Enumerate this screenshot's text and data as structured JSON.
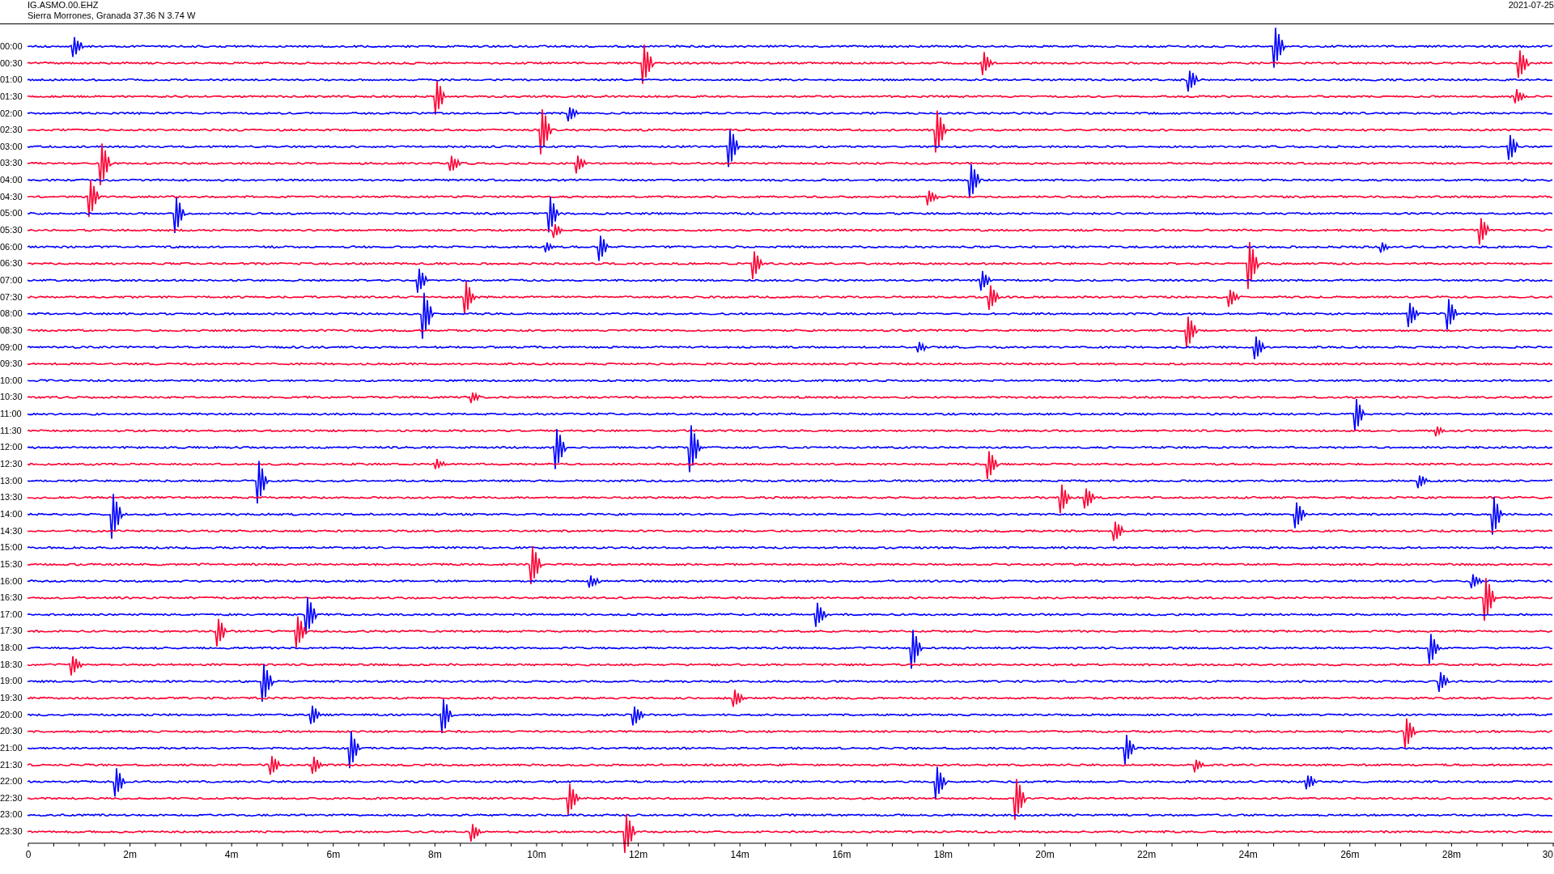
{
  "header": {
    "station": "IG.ASMO.00.EHZ",
    "location": "Sierra Morrones, Granada  37.36 N 3.74 W",
    "date": "2021-07-25"
  },
  "rows": [
    {
      "time": "00:00",
      "color": "#0000ff"
    },
    {
      "time": "00:30",
      "color": "#ff0033"
    },
    {
      "time": "01:00",
      "color": "#0000ff"
    },
    {
      "time": "01:30",
      "color": "#ff0033"
    },
    {
      "time": "02:00",
      "color": "#0000ff"
    },
    {
      "time": "02:30",
      "color": "#ff0033"
    },
    {
      "time": "03:00",
      "color": "#0000ff"
    },
    {
      "time": "03:30",
      "color": "#ff0033"
    },
    {
      "time": "04:00",
      "color": "#0000ff"
    },
    {
      "time": "04:30",
      "color": "#ff0033"
    },
    {
      "time": "05:00",
      "color": "#0000ff"
    },
    {
      "time": "05:30",
      "color": "#ff0033"
    },
    {
      "time": "06:00",
      "color": "#0000ff"
    },
    {
      "time": "06:30",
      "color": "#ff0033"
    },
    {
      "time": "07:00",
      "color": "#0000ff"
    },
    {
      "time": "07:30",
      "color": "#ff0033"
    },
    {
      "time": "08:00",
      "color": "#0000ff"
    },
    {
      "time": "08:30",
      "color": "#ff0033"
    },
    {
      "time": "09:00",
      "color": "#0000ff"
    },
    {
      "time": "09:30",
      "color": "#ff0033"
    },
    {
      "time": "10:00",
      "color": "#0000ff"
    },
    {
      "time": "10:30",
      "color": "#ff0033"
    },
    {
      "time": "11:00",
      "color": "#0000ff"
    },
    {
      "time": "11:30",
      "color": "#ff0033"
    },
    {
      "time": "12:00",
      "color": "#0000ff"
    },
    {
      "time": "12:30",
      "color": "#ff0033"
    },
    {
      "time": "13:00",
      "color": "#0000ff"
    },
    {
      "time": "13:30",
      "color": "#ff0033"
    },
    {
      "time": "14:00",
      "color": "#0000ff"
    },
    {
      "time": "14:30",
      "color": "#ff0033"
    },
    {
      "time": "15:00",
      "color": "#0000ff"
    },
    {
      "time": "15:30",
      "color": "#ff0033"
    },
    {
      "time": "16:00",
      "color": "#0000ff"
    },
    {
      "time": "16:30",
      "color": "#ff0033"
    },
    {
      "time": "17:00",
      "color": "#0000ff"
    },
    {
      "time": "17:30",
      "color": "#ff0033"
    },
    {
      "time": "18:00",
      "color": "#0000ff"
    },
    {
      "time": "18:30",
      "color": "#ff0033"
    },
    {
      "time": "19:00",
      "color": "#0000ff"
    },
    {
      "time": "19:30",
      "color": "#ff0033"
    },
    {
      "time": "20:00",
      "color": "#0000ff"
    },
    {
      "time": "20:30",
      "color": "#ff0033"
    },
    {
      "time": "21:00",
      "color": "#0000ff"
    },
    {
      "time": "21:30",
      "color": "#ff0033"
    },
    {
      "time": "22:00",
      "color": "#0000ff"
    },
    {
      "time": "22:30",
      "color": "#ff0033"
    },
    {
      "time": "23:00",
      "color": "#0000ff"
    },
    {
      "time": "23:30",
      "color": "#ff0033"
    }
  ],
  "x_axis": {
    "ticks": [
      "0",
      "2m",
      "4m",
      "6m",
      "8m",
      "10m",
      "12m",
      "14m",
      "16m",
      "18m",
      "20m",
      "22m",
      "24m",
      "26m",
      "28m",
      "30"
    ]
  }
}
